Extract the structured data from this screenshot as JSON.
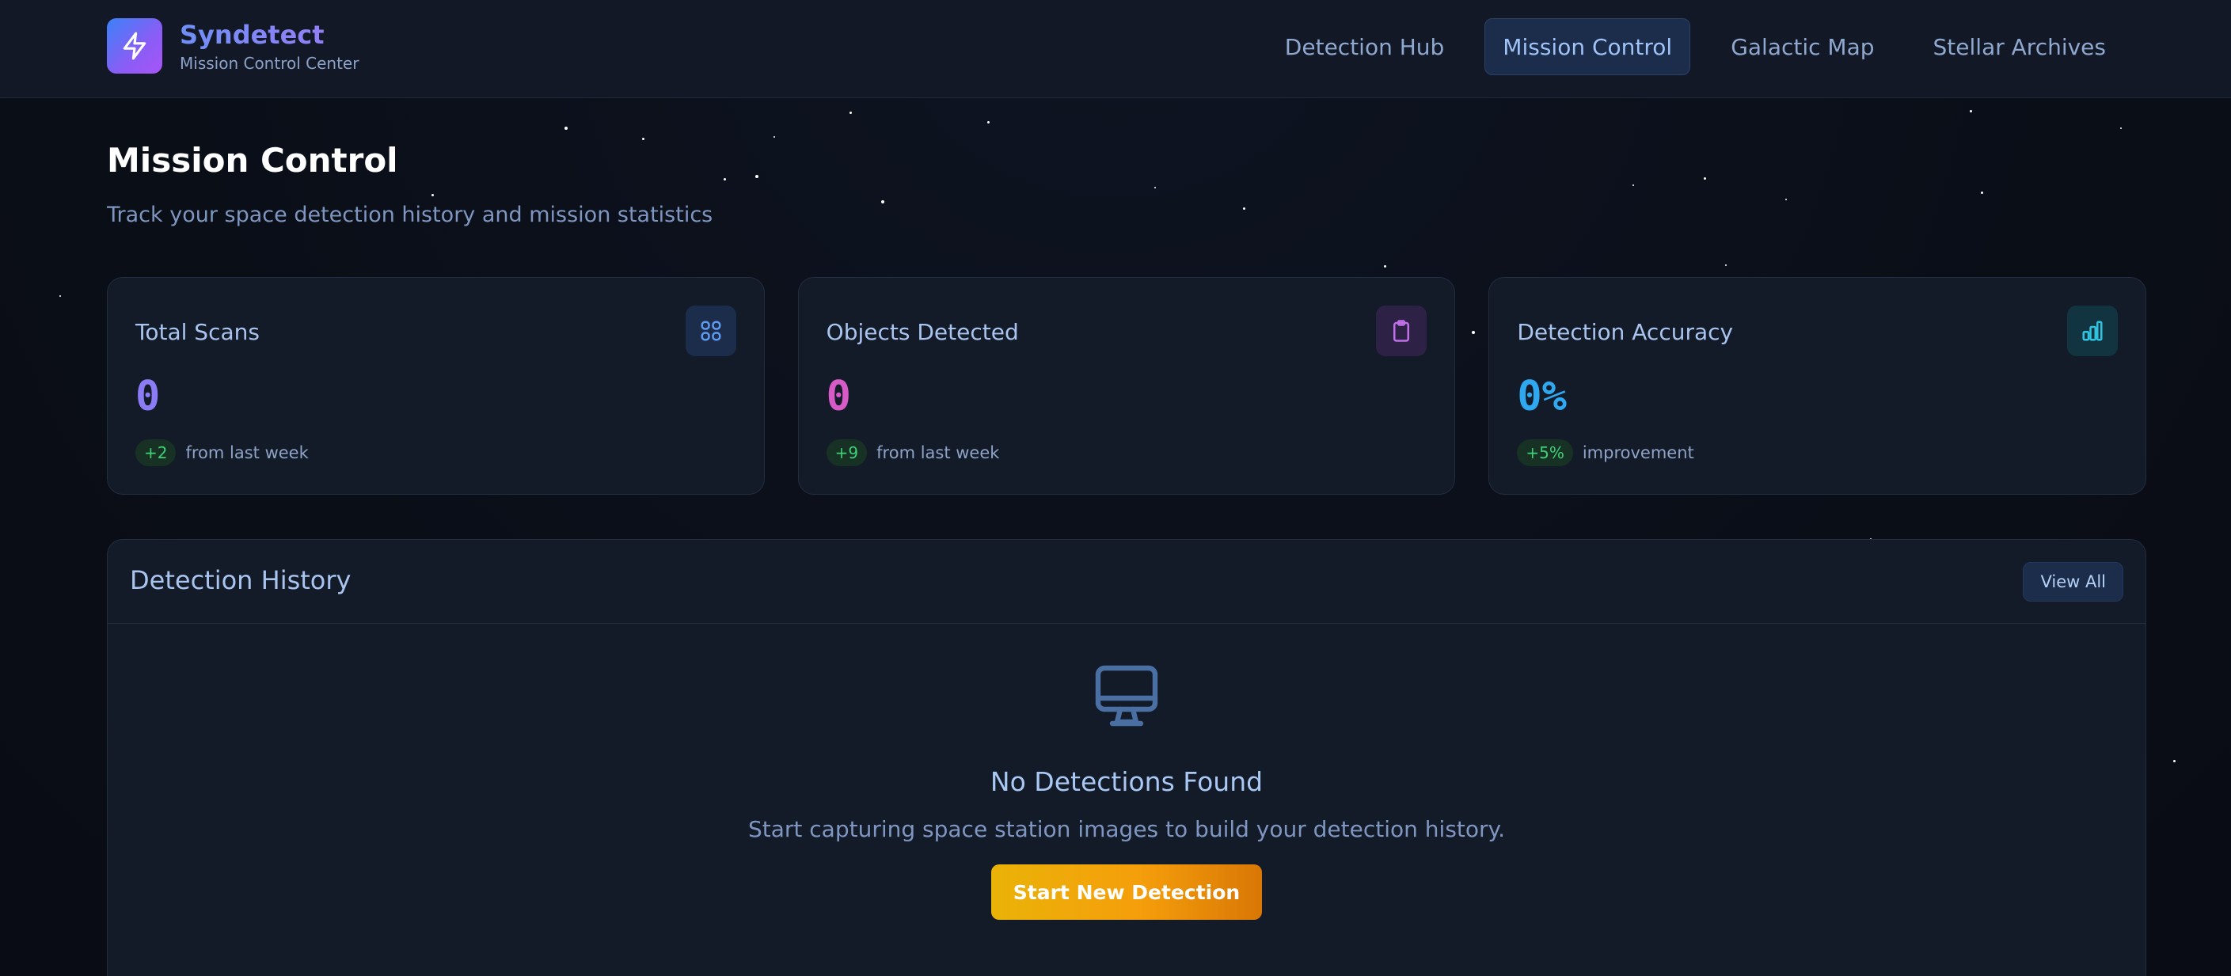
{
  "brand": {
    "name": "Syndetect",
    "subtitle": "Mission Control Center",
    "logo_icon": "lightning-bolt-icon"
  },
  "nav": {
    "items": [
      {
        "label": "Detection Hub",
        "active": false
      },
      {
        "label": "Mission Control",
        "active": true
      },
      {
        "label": "Galactic Map",
        "active": false
      },
      {
        "label": "Stellar Archives",
        "active": false
      }
    ]
  },
  "header": {
    "title": "Mission Control",
    "subtitle": "Track your space detection history and mission statistics"
  },
  "stats": [
    {
      "label": "Total Scans",
      "value": "0",
      "badge": "+2",
      "note": "from last week",
      "icon": "grid-icon",
      "value_color": "#8b7cf6"
    },
    {
      "label": "Objects Detected",
      "value": "0",
      "badge": "+9",
      "note": "from last week",
      "icon": "clipboard-icon",
      "value_color": "#d65bc6"
    },
    {
      "label": "Detection Accuracy",
      "value": "0%",
      "badge": "+5%",
      "note": "improvement",
      "icon": "bar-chart-icon",
      "value_color": "#2fa8f0"
    }
  ],
  "history": {
    "title": "Detection History",
    "view_all": "View All",
    "empty_icon": "monitor-icon",
    "empty_title": "No Detections Found",
    "empty_text": "Start capturing space station images to build your detection history.",
    "cta": "Start New Detection"
  },
  "colors": {
    "background": "#0a0e17",
    "card": "#131a28",
    "accent_blue": "#1c2c4b",
    "cta_from": "#eab308",
    "cta_to": "#d97706",
    "badge_green": "#3fcf77"
  }
}
